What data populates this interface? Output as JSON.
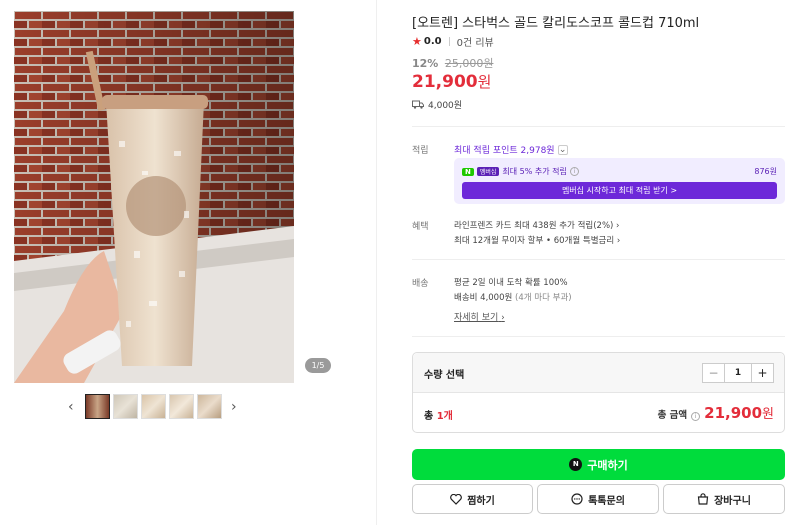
{
  "gallery": {
    "counter": "1/5",
    "thumb_count": 5,
    "prev_icon": "chevron-left-icon",
    "next_icon": "chevron-right-icon"
  },
  "product": {
    "title": "[오트렌] 스타벅스 골드 칼리도스코프 콜드컵 710ml",
    "rating": "0.0",
    "reviews": "0건 리뷰",
    "discount": "12%",
    "original_price": "25,000원",
    "price": "21,900",
    "price_unit": "원",
    "shipping_fee": "4,000원"
  },
  "points": {
    "label": "적립",
    "max": "최대 적립 포인트 2,978원",
    "extra_badge_n": "N",
    "extra_badge_plus": "멤버십",
    "extra_text": "최대 5% 추가 적립",
    "extra_amount": "876원",
    "cta": "멤버십 시작하고 최대 적립 받기 >"
  },
  "benefit": {
    "label": "혜택",
    "line1": "라인프렌즈 카드 최대 438원 추가 적립(2%)",
    "line2": "최대 12개월 무이자 할부 • 60개월 특별금리"
  },
  "delivery": {
    "label": "배송",
    "line1": "평균 2일 이내 도착 확률 100%",
    "line2": "배송비 4,000원",
    "line2_note": "(4개 마다 부과)",
    "more": "자세히 보기"
  },
  "quantity": {
    "label": "수량 선택",
    "value": "1",
    "minus": "−",
    "plus": "+",
    "total_prefix": "총",
    "total_count": "1개",
    "total_label": "총 금액",
    "total_value": "21,900",
    "total_unit": "원"
  },
  "actions": {
    "buy": "구매하기",
    "wish": "찜하기",
    "talk": "톡톡문의",
    "cart": "장바구니"
  },
  "colors": {
    "price_red": "#e32d3a",
    "naver_green": "#00dc3c",
    "membership_purple": "#6d28d9"
  }
}
